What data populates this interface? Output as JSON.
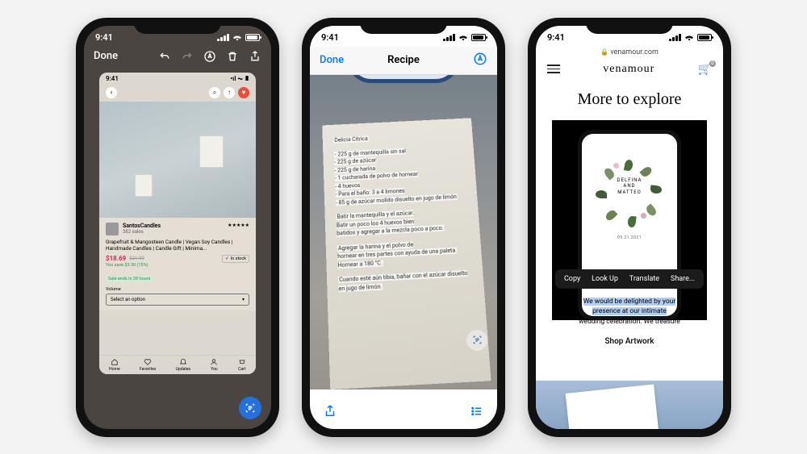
{
  "status_time": "9:41",
  "phone1": {
    "done": "Done",
    "inner_time": "9:41",
    "seller_name": "SantosCandles",
    "seller_sales": "382 sales",
    "stars": "★★★★★",
    "product_title": "Grapefruit & Mangosteen Candle | Vegan Soy Candles | Handmade Candles | Candle Gift | Minima...",
    "price_now": "$18.69",
    "price_was": "$21.99",
    "savings": "You save $3.30 (15%)",
    "stock": "In stock",
    "sale_ends": "Sale ends in 28 hours",
    "volume_label": "Volume",
    "select_option": "Select an option",
    "nav": [
      "Home",
      "Favorites",
      "Updates",
      "You",
      "Cart"
    ]
  },
  "phone2": {
    "done": "Done",
    "title": "Recipe",
    "recipe_title": "Delicia Cítrica",
    "ingredients": "- 225 g de mantequilla sin sal\n- 225 g de azúcar\n- 225 g de harina\n- 1 cucharada de polvo de hornear\n- 4 huevos\n- Para el baño: 3 a 4 limones\n- 85 g de azúcar molido disuelto en jugo de limón",
    "para1": "Batir la mantequilla y el azúcar.\nBatir un poco los 4 huevos bien\nbatidos y agregar a la mezcla poco a poco.",
    "para2": "Agregar la harina y el polvo de\nhornear en tres partes con ayuda de una paleta.\nHornear a 180 °C.",
    "para3": "Cuando esté aún tibia, bañar con el azúcar disuelto en jugo de limón."
  },
  "phone3": {
    "url": "venamour.com",
    "brand": "venamour",
    "cart_count": "0",
    "heading": "More to explore",
    "invite_line1": "DELFINA",
    "invite_line2": "AND",
    "invite_line3": "MATTEO",
    "invite_date": "09.21.2021",
    "context_menu": [
      "Copy",
      "Look Up",
      "Translate",
      "Share..."
    ],
    "selected_text1": "We would be delighted by your",
    "selected_text2": "presence at our intimate",
    "selected_text3": "wedding celebration. We treasure",
    "shop_label": "Shop Artwork"
  }
}
